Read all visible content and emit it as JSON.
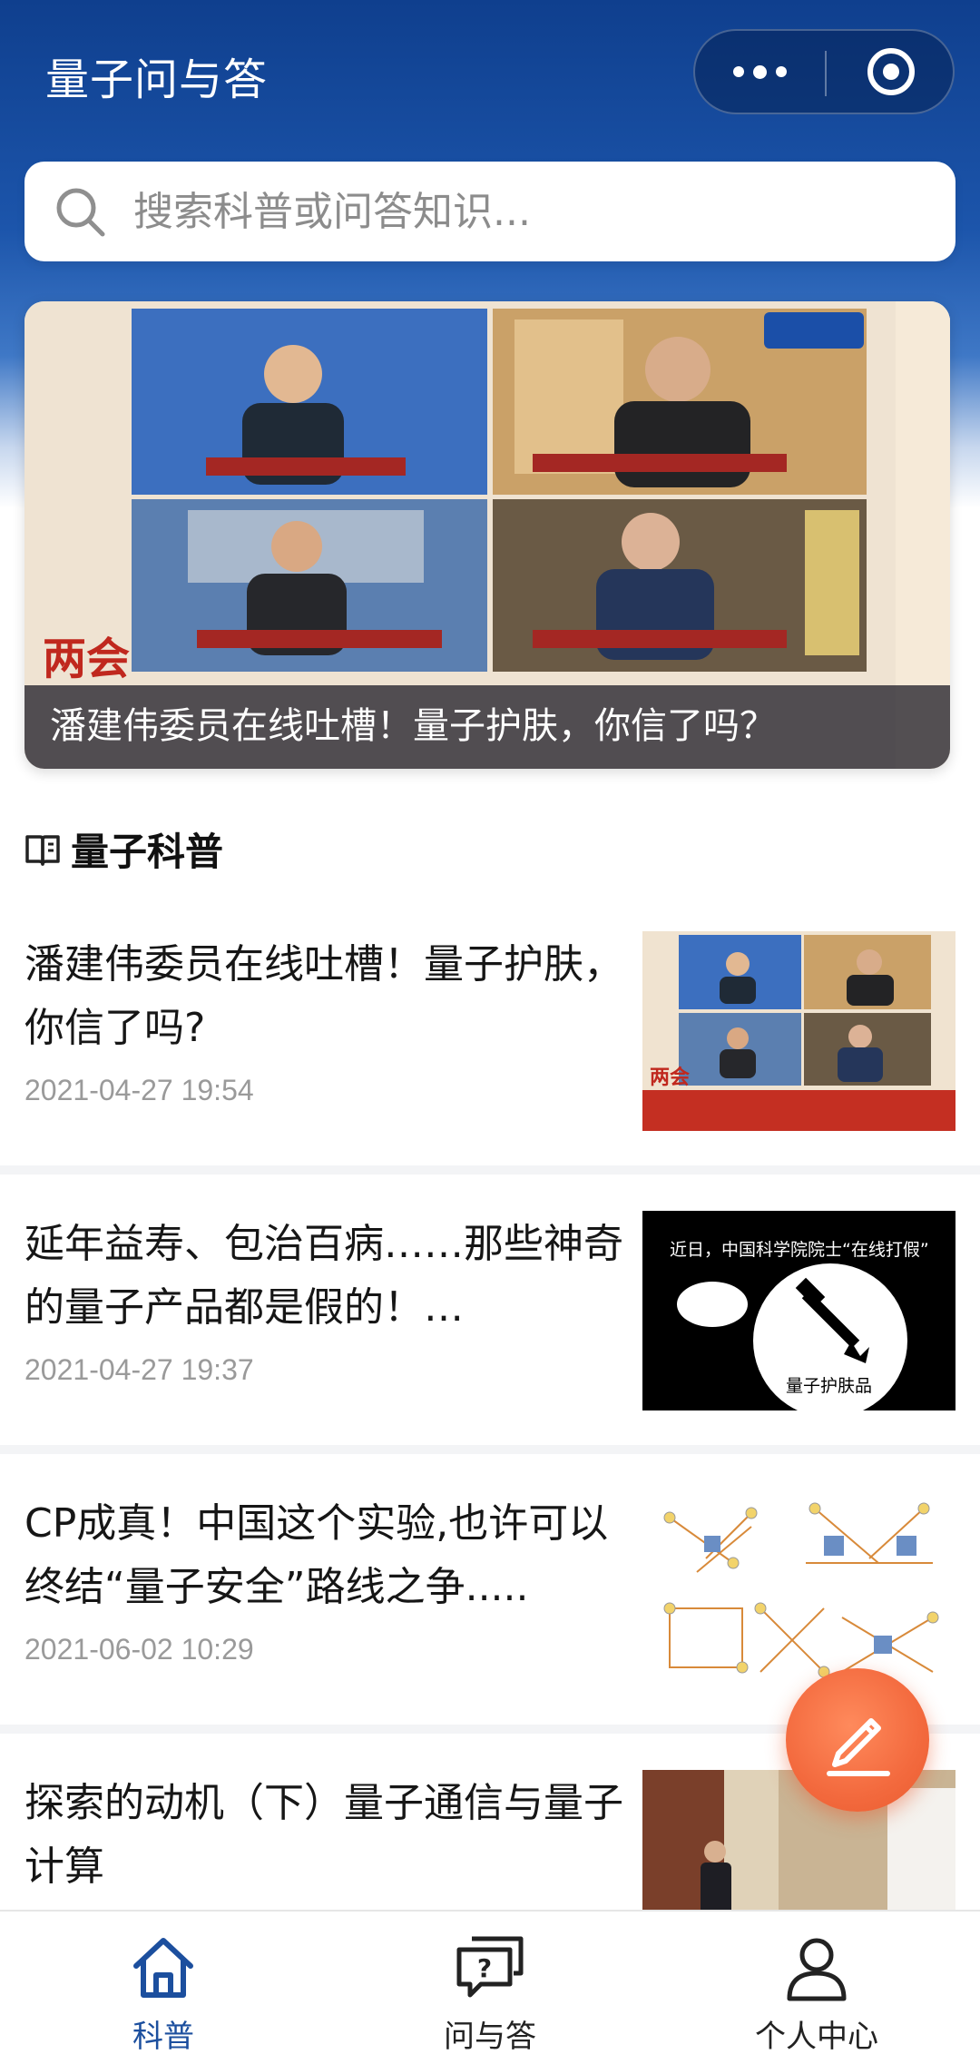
{
  "header": {
    "title": "量子问与答",
    "more_icon": "more-dots-icon",
    "close_icon": "target-circle-icon"
  },
  "search": {
    "placeholder": "搜索科普或问答知识..."
  },
  "banner": {
    "caption": "潘建伟委员在线吐槽！量子护肤，你信了吗？"
  },
  "section": {
    "icon": "book-open-icon",
    "title": "量子科普"
  },
  "articles": [
    {
      "title": "潘建伟委员在线吐槽！量子护肤，你信了吗?",
      "date": "2021-04-27 19:54"
    },
    {
      "title": "延年益寿、包治百病……那些神奇的量子产品都是假的！…",
      "date": "2021-04-27 19:37",
      "thumb_text": {
        "top": "近日，中国科学院院士“在线打假”",
        "product": "量子护肤品"
      }
    },
    {
      "title": "CP成真！中国这个实验,也许可以终结“量子安全”路线之争.....",
      "date": "2021-06-02 10:29"
    },
    {
      "title": "探索的动机（下）量子通信与量子计算",
      "date": ""
    }
  ],
  "fab": {
    "icon": "pencil-icon"
  },
  "tabbar": {
    "items": [
      {
        "label": "科普",
        "icon": "home-icon",
        "active": true
      },
      {
        "label": "问与答",
        "icon": "question-chat-icon",
        "active": false
      },
      {
        "label": "个人中心",
        "icon": "person-icon",
        "active": false
      }
    ]
  },
  "colors": {
    "header_blue": "#1c4f9e",
    "accent_orange": "#f36a3e",
    "date_gray": "#9a9a9a"
  }
}
